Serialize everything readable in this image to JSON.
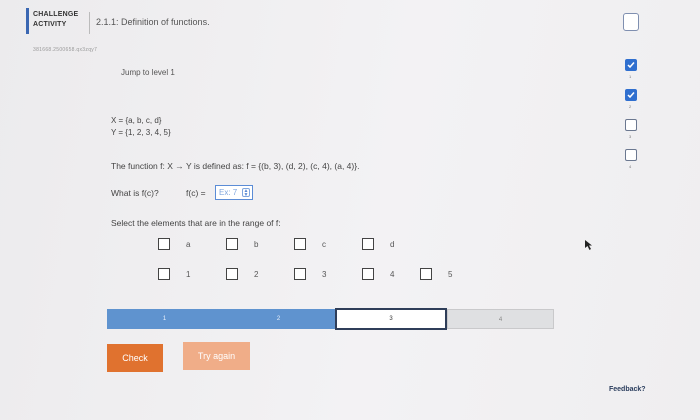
{
  "header": {
    "challenge_label": "CHALLENGE ACTIVITY",
    "title": "2.1.1: Definition of functions.",
    "activity_id": "381668.2500658.qx3zqy7"
  },
  "jump_level": "Jump to level 1",
  "sets": {
    "x_line": "X = {a, b, c, d}",
    "y_line": "Y = {1, 2, 3, 4, 5}"
  },
  "function_definition": "The function f: X → Y is defined as: f = {(b, 3), (d, 2), (c, 4), (a, 4)}.",
  "question": {
    "what_is": "What is f(c)?",
    "fc_label": "f(c) =",
    "answer_placeholder": "Ex: 7",
    "answer_value": ""
  },
  "select_prompt": "Select the elements that are in the range of f:",
  "domain_choices": [
    "a",
    "b",
    "c",
    "d"
  ],
  "range_choices": [
    "1",
    "2",
    "3",
    "4",
    "5"
  ],
  "progress": {
    "levels": [
      "1",
      "2",
      "3",
      "4"
    ],
    "current_level": 3
  },
  "buttons": {
    "check_label": "Check",
    "try_again_label": "Try again"
  },
  "feedback_label": "Feedback?",
  "level_badges": [
    {
      "status": "completed",
      "number": "1"
    },
    {
      "status": "completed",
      "number": "2"
    },
    {
      "status": "open",
      "number": "3"
    },
    {
      "status": "open",
      "number": "4"
    }
  ],
  "colors": {
    "accent": "#3a67b2",
    "progress_fill": "#5f93cf",
    "check_button": "#e0722f",
    "try_again_button": "#f0ad88",
    "badge_done": "#2f6fcf"
  },
  "icons": {
    "activity_badge": "badge-outline-icon",
    "level_done": "checkmark-icon",
    "cursor": "mouse-pointer-icon"
  }
}
